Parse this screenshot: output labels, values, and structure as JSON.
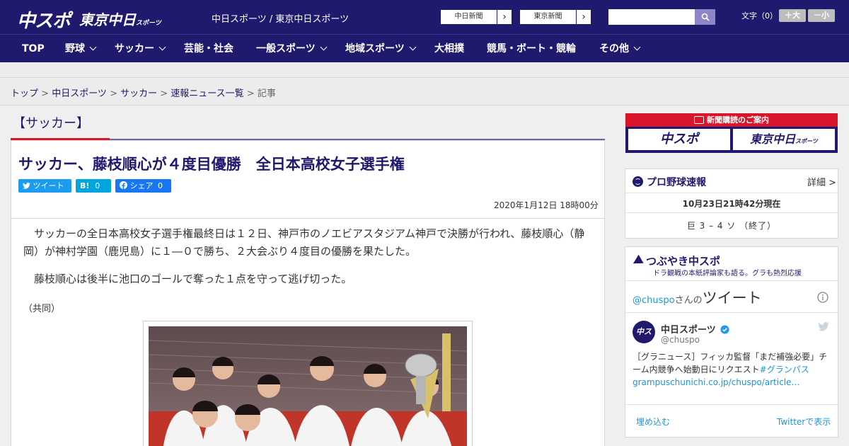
{
  "header": {
    "logo_primary": "中スポ",
    "logo_secondary": "東京中日",
    "logo_secondary_small": "スポーツ",
    "site_title": "中日スポーツ / 東京中日スポーツ",
    "ext_links": [
      "中日新聞",
      "東京新聞"
    ],
    "search_placeholder": "",
    "fontsize_label": "文字（0）",
    "fontsize_plus": "＋大",
    "fontsize_minus": "－小"
  },
  "nav": {
    "items": [
      {
        "label": "TOP",
        "has_menu": false
      },
      {
        "label": "野球",
        "has_menu": true
      },
      {
        "label": "サッカー",
        "has_menu": true
      },
      {
        "label": "芸能・社会",
        "has_menu": false
      },
      {
        "label": "一般スポーツ",
        "has_menu": true
      },
      {
        "label": "地域スポーツ",
        "has_menu": true
      },
      {
        "label": "大相撲",
        "has_menu": false
      },
      {
        "label": "競馬・ボート・競輪",
        "has_menu": false
      },
      {
        "label": "その他",
        "has_menu": true
      }
    ]
  },
  "breadcrumb": {
    "items": [
      "トップ",
      "中日スポーツ",
      "サッカー",
      "速報ニュース一覧"
    ],
    "current": "記事",
    "separator": " > "
  },
  "article": {
    "category": "【サッカー】",
    "headline": "サッカー、藤枝順心が４度目優勝　全日本高校女子選手権",
    "share": {
      "tweet": "ツイート",
      "hatena": "B!",
      "hatena_count": "0",
      "facebook": "シェア",
      "facebook_count": "0"
    },
    "date": "2020年1月12日 18時00分",
    "paragraphs": [
      "　サッカーの全日本高校女子選手権最終日は１２日、神戸市のノエビアスタジアム神戸で決勝が行われ、藤枝順心（静岡）が神村学園（鹿児島）に１―０で勝ち、２大会ぶり４度目の優勝を果たした。",
      "　藤枝順心は後半に池口のゴールで奪った１点を守って逃げ切った。"
    ],
    "credit": "（共同）"
  },
  "sidebar": {
    "subscription": {
      "title": "新聞購読のご案内",
      "logos": [
        "中スポ",
        "東京中日"
      ],
      "logo_secondary_small": "スポーツ"
    },
    "baseball": {
      "title": "プロ野球速報",
      "detail": "詳細 >",
      "time": "10月23日21時42分現在",
      "score": "巨 3 – 4 ソ （終了）"
    },
    "tsubuyaki": {
      "title": "つぶやき中スポ",
      "subtitle": "ドラ観戦の本紙評論家も語る。グラも熱烈応援"
    },
    "twitter": {
      "header_user": "@chuspo",
      "header_mid": "さんの",
      "header_tail": "ツイート",
      "name": "中日スポーツ",
      "handle": "@chuspo",
      "avatar_text": "中スポ",
      "tweet_text": "［グラニュース］フィッカ監督「まだ補強必要」チーム内競争へ始動日にリクエスト",
      "tweet_hashtag": "#グランパス",
      "tweet_link": "grampuschunichi.co.jp/chuspo/article…",
      "embed": "埋め込む",
      "view_on": "Twitterで表示"
    }
  },
  "colors": {
    "brand_navy": "#1f1a6e",
    "accent_red": "#d9152b",
    "twitter_blue": "#1d9bf0"
  }
}
